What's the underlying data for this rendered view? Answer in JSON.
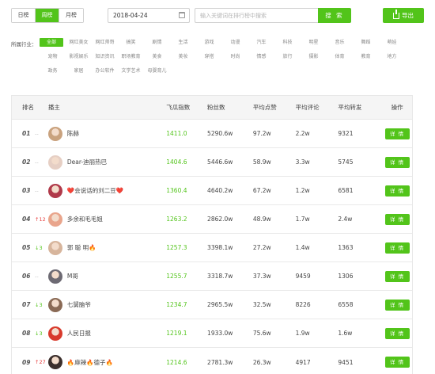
{
  "toolbar": {
    "tabs": [
      {
        "label": "日榜",
        "active": false
      },
      {
        "label": "周榜",
        "active": true
      },
      {
        "label": "月榜",
        "active": false
      }
    ],
    "date": "2018-04-24",
    "search_placeholder": "输入关键词在排行榜中搜索",
    "search_label": "搜 索",
    "export_label": "导出",
    "accent_color": "#52c41a"
  },
  "industry": {
    "label": "所属行业：",
    "tags": [
      "全部",
      "网红美女",
      "网红帅哥",
      "搞笑",
      "剧情",
      "生活",
      "游戏",
      "动漫",
      "汽车",
      "科技",
      "明星",
      "音乐",
      "舞蹈",
      "萌娃",
      "宠物",
      "影视娱乐",
      "知识资讯",
      "职场教育",
      "美食",
      "美妆",
      "穿搭",
      "时尚",
      "情感",
      "旅行",
      "摄影",
      "体育",
      "教育",
      "地方",
      "政务",
      "家居",
      "办公软件",
      "文学艺术",
      "母婴育儿"
    ],
    "active_index": 0
  },
  "table": {
    "headers": {
      "rank": "排名",
      "host": "播主",
      "index": "飞瓜指数",
      "fans": "粉丝数",
      "avg_like": "平均点赞",
      "avg_comment": "平均评论",
      "avg_forward": "平均转发",
      "action": "操作"
    },
    "detail_label": "详 情",
    "rows": [
      {
        "rank": "01",
        "change": "--",
        "dir": "flat",
        "name": "陈赫",
        "index": "1411.0",
        "fans": "5290.6w",
        "like": "97.2w",
        "comment": "2.2w",
        "forward": "9321",
        "avatar_color": "#c9a27e"
      },
      {
        "rank": "02",
        "change": "--",
        "dir": "flat",
        "name": "Dear-迪丽热巴",
        "index": "1404.6",
        "fans": "5446.6w",
        "like": "58.9w",
        "comment": "3.3w",
        "forward": "5745",
        "avatar_color": "#e6cfc4"
      },
      {
        "rank": "03",
        "change": "--",
        "dir": "flat",
        "name": "❤️会说话的刘二豆❤️",
        "index": "1360.4",
        "fans": "4640.2w",
        "like": "67.2w",
        "comment": "1.2w",
        "forward": "6581",
        "avatar_color": "#b03a4a"
      },
      {
        "rank": "04",
        "change": "12",
        "dir": "up",
        "name": "多余和毛毛姐",
        "index": "1263.2",
        "fans": "2862.0w",
        "like": "48.9w",
        "comment": "1.7w",
        "forward": "2.4w",
        "avatar_color": "#e9a58c"
      },
      {
        "rank": "05",
        "change": "3",
        "dir": "down",
        "name": "郭 聪 明🔥",
        "index": "1257.3",
        "fans": "3398.1w",
        "like": "27.2w",
        "comment": "1.4w",
        "forward": "1363",
        "avatar_color": "#d7b59c"
      },
      {
        "rank": "06",
        "change": "--",
        "dir": "flat",
        "name": "M哥",
        "index": "1255.7",
        "fans": "3318.7w",
        "like": "37.3w",
        "comment": "9459",
        "forward": "1306",
        "avatar_color": "#6d6a73"
      },
      {
        "rank": "07",
        "change": "3",
        "dir": "down",
        "name": "七舅脑爷",
        "index": "1234.7",
        "fans": "2965.5w",
        "like": "32.5w",
        "comment": "8226",
        "forward": "6558",
        "avatar_color": "#8a6a55"
      },
      {
        "rank": "08",
        "change": "3",
        "dir": "down",
        "name": "人民日报",
        "index": "1219.1",
        "fans": "1933.0w",
        "like": "75.6w",
        "comment": "1.9w",
        "forward": "1.6w",
        "avatar_color": "#d83a2c"
      },
      {
        "rank": "09",
        "change": "27",
        "dir": "up",
        "name": "🔥麻辣🔥德子🔥",
        "index": "1214.6",
        "fans": "2781.3w",
        "like": "26.3w",
        "comment": "4917",
        "forward": "9451",
        "avatar_color": "#3b2f2c"
      }
    ]
  }
}
